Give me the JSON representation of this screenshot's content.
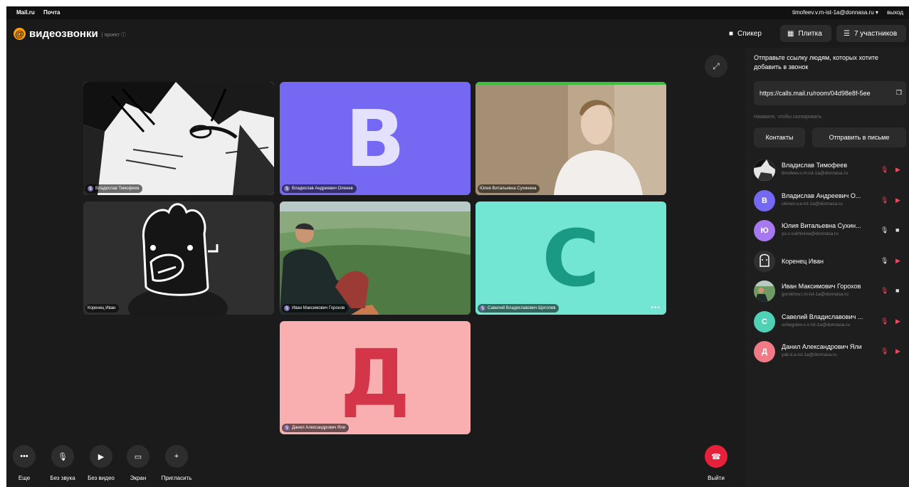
{
  "topbar": {
    "left": [
      "Mail.ru",
      "Почта"
    ],
    "user_email": "timofeev.v.m-ist-1a@donnasa.ru ▾",
    "logout": "выход"
  },
  "header": {
    "logo_symbol": "@",
    "logo_text": "видеозвонки",
    "logo_badge": "| проект ⓘ",
    "speaker": "Спикер",
    "tile": "Плитка",
    "participants": "7 участников",
    "speaker_icon": "monitor-icon",
    "tile_icon": "grid-icon",
    "participants_icon": "list-icon"
  },
  "tiles": [
    {
      "name": "Владислав Тимофеев",
      "kind": "manga",
      "muted": true
    },
    {
      "name": "Владислав Андреевич Оленев",
      "kind": "letter",
      "letter": "В",
      "bg": "#7569f3",
      "fg": "#e4e1ff",
      "muted": true
    },
    {
      "name": "Юлия Витальевна Сухинина",
      "kind": "photo-room",
      "muted": false
    },
    {
      "name": "Коренец Иван",
      "kind": "drawing",
      "muted": false
    },
    {
      "name": "Иван Максимович Горохов",
      "kind": "photo-mountain",
      "muted": true
    },
    {
      "name": "Савелий Владиславович Щеголев",
      "kind": "letter",
      "letter": "С",
      "bg": "#72e6d3",
      "fg": "#1a9a84",
      "muted": true,
      "more": "•••"
    },
    {
      "name": "Данил Александрович Яли",
      "kind": "letter",
      "letter": "Д",
      "bg": "#f9aeb0",
      "fg": "#d43549",
      "muted": true
    }
  ],
  "controls": [
    {
      "label": "Еще",
      "glyph": "•••"
    },
    {
      "label": "Без звука",
      "glyph": "🎙"
    },
    {
      "label": "Без видео",
      "glyph": "▶"
    },
    {
      "label": "Экран",
      "glyph": "▭"
    },
    {
      "label": "Пригласить",
      "glyph": "+"
    }
  ],
  "exit": {
    "label": "Выйти",
    "glyph": "☎"
  },
  "sidebar": {
    "title": "Отправьте ссылку людям, которых хотите добавить в звонок",
    "link": "https://calls.mail.ru/room/04d98e8f-5ee",
    "copy_icon": "copy-icon",
    "hint": "Нажмите, чтобы скопировать",
    "contacts": "Контакты",
    "send_mail": "Отправить в письме",
    "participants": [
      {
        "name": "Владислав Тимофеев",
        "email": "timofeev.v.m-ist-1a@donnasa.ru",
        "avatar": "img-manga",
        "mic": "muted",
        "cam": "off"
      },
      {
        "name": "Владислав Андреевич О...",
        "email": "olenev.v.a-ist-1a@donnasa.ru",
        "avatar": "В",
        "color": "#7569f3",
        "mic": "muted",
        "cam": "off"
      },
      {
        "name": "Юлия Витальевна Сухин...",
        "email": "yu.v.sukhinina@donnasa.ru",
        "avatar": "Ю",
        "color": "#a779f0",
        "mic": "on",
        "cam": "on"
      },
      {
        "name": "Коренец Иван",
        "email": "",
        "avatar": "img-drawing",
        "mic": "on",
        "cam": "off"
      },
      {
        "name": "Иван Максимович Горохов",
        "email": "gorokhov.i.m-ist-1a@donnasa.ru",
        "avatar": "img-mountain",
        "mic": "muted",
        "cam": "on"
      },
      {
        "name": "Савелий Владиславович ...",
        "email": "schegolev.s.v-ist-1a@donnasa.ru",
        "avatar": "С",
        "color": "#4fd1b6",
        "mic": "muted",
        "cam": "off"
      },
      {
        "name": "Данил Александрович Яли",
        "email": "yali.d.a-ist-1a@donnasa.ru",
        "avatar": "Д",
        "color": "#f07a86",
        "mic": "muted",
        "cam": "off"
      }
    ]
  }
}
